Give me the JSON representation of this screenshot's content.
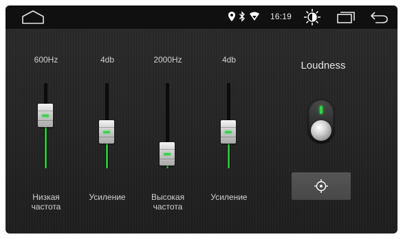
{
  "status_bar": {
    "time": "16:19",
    "icons": [
      "home-icon",
      "location-icon",
      "bluetooth-icon",
      "wifi-icon",
      "brightness-icon",
      "recents-icon",
      "back-icon"
    ]
  },
  "equalizer": {
    "bands": [
      {
        "value": "600Hz",
        "label_line1": "Низкая",
        "label_line2": "частота",
        "level": 0.65
      },
      {
        "value": "4db",
        "label_line1": "Усиление",
        "label_line2": "",
        "level": 0.42
      },
      {
        "value": "2000Hz",
        "label_line1": "Высокая",
        "label_line2": "частота",
        "level": 0.12
      },
      {
        "value": "4db",
        "label_line1": "Усиление",
        "label_line2": "",
        "level": 0.42
      }
    ]
  },
  "loudness": {
    "title": "Loudness",
    "enabled": true,
    "button_icon": "target-icon"
  },
  "colors": {
    "accent": "#35d24a",
    "status_bar_bg": "#101010",
    "panel_bg": "#262626"
  }
}
